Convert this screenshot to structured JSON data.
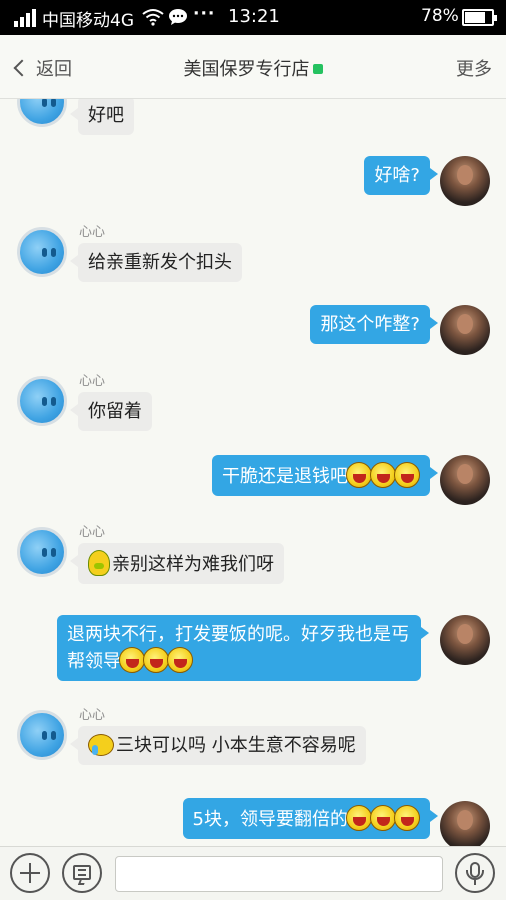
{
  "status_bar": {
    "carrier": "中国移动4G",
    "dots": "···",
    "time": "13:21",
    "battery": "78%",
    "battery_level": 0.78
  },
  "header": {
    "back_label": "返回",
    "title": "美国保罗专行店",
    "more_label": "更多",
    "online_color": "#25c260"
  },
  "messages": [
    {
      "side": "left",
      "sender": "",
      "text": "好吧"
    },
    {
      "side": "right",
      "text": "好啥?"
    },
    {
      "side": "left",
      "sender": "心心",
      "text": "给亲重新发个扣头"
    },
    {
      "side": "right",
      "text": "那这个咋整?"
    },
    {
      "side": "left",
      "sender": "心心",
      "text": "你留着"
    },
    {
      "side": "right",
      "text": "干脆还是退钱吧",
      "emojis": 3
    },
    {
      "side": "left",
      "sender": "心心",
      "text": "亲别这样为难我们呀",
      "lead_emoji": "shy"
    },
    {
      "side": "right",
      "line1": "退两块不行，打发要饭的呢。好歹我也是丐",
      "line2": "帮领导",
      "emojis": 3
    },
    {
      "side": "left",
      "sender": "心心",
      "text": "三块可以吗  小本生意不容易呢",
      "lead_emoji": "cry"
    },
    {
      "side": "right",
      "text": "5块，领导要翻倍的",
      "emojis": 3
    }
  ],
  "colors": {
    "bubble_right": "#33a6e4",
    "bubble_left": "#ececea",
    "background": "#f7f8f3"
  },
  "bottom_bar": {
    "input_placeholder": "",
    "icons": [
      "plus-icon",
      "message-icon",
      "microphone-icon"
    ]
  }
}
